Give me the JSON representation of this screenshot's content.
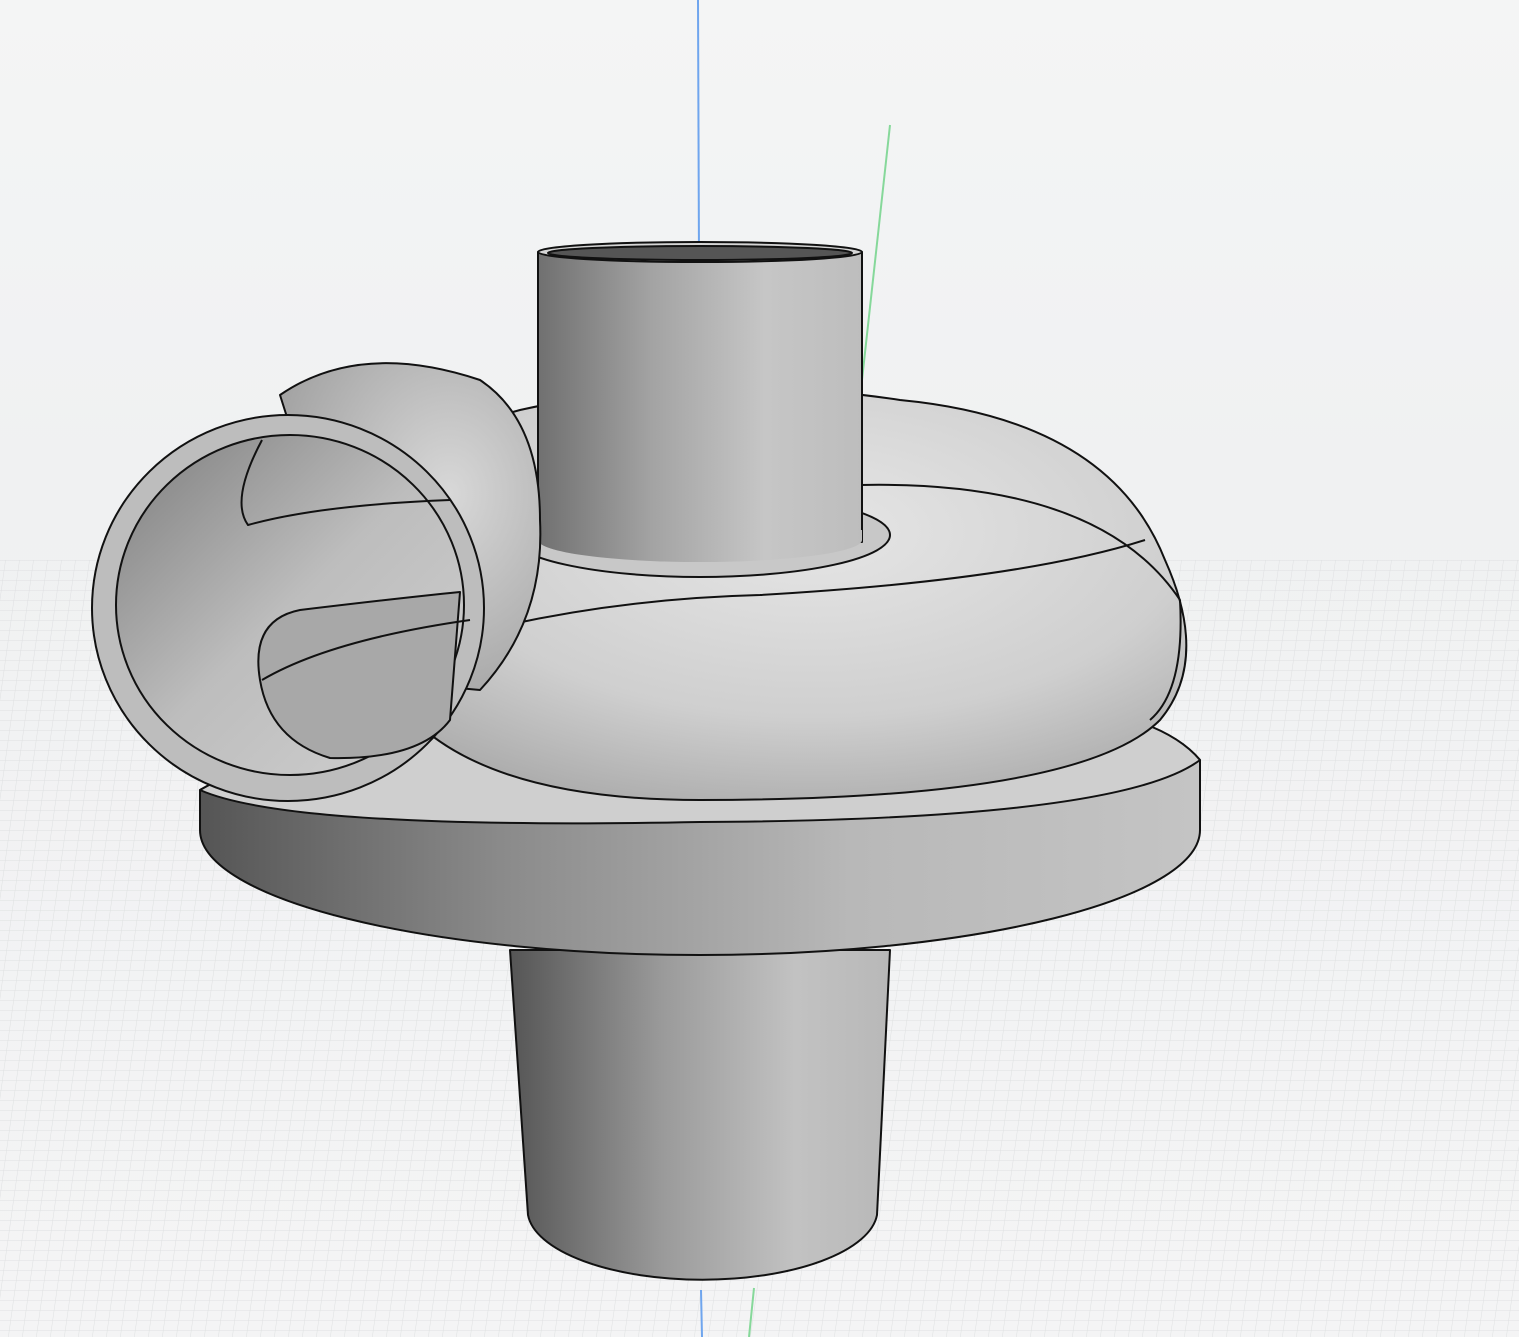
{
  "viewport": {
    "kind": "3d-cad-viewport",
    "model_name": "pump-volute-housing",
    "background": "#f2f3f4",
    "model_color": "#b3b3b3",
    "edge_color": "#111111",
    "grid_color": "#dcdedf",
    "axes": [
      {
        "name": "z-axis-line",
        "color": "#6fa5ee"
      },
      {
        "name": "y-axis-line",
        "color": "#86d89a"
      }
    ]
  }
}
